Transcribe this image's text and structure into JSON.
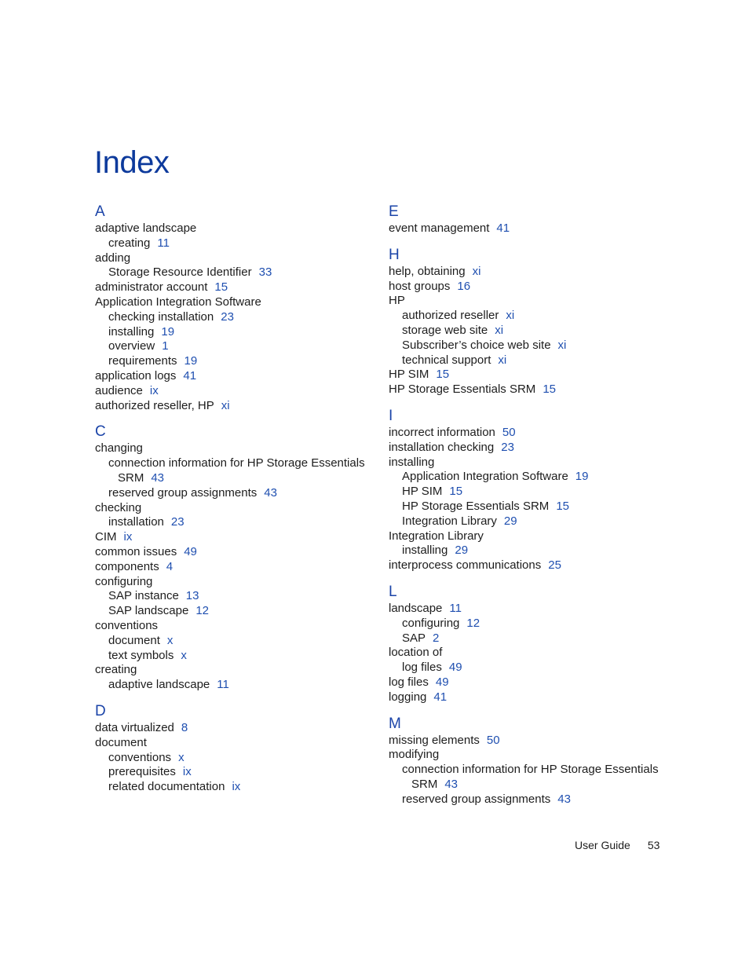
{
  "page": {
    "title": "Index",
    "footer": {
      "label": "User Guide",
      "page_number": "53"
    },
    "accent_color": "#1f4fb0"
  },
  "left_sections": [
    {
      "letter": "A",
      "entries": [
        {
          "text": "adaptive landscape",
          "page": "",
          "level": 0
        },
        {
          "text": "creating",
          "page": "11",
          "level": 1
        },
        {
          "text": "adding",
          "page": "",
          "level": 0
        },
        {
          "text": "Storage Resource Identifier",
          "page": "33",
          "level": 1
        },
        {
          "text": "administrator account",
          "page": "15",
          "level": 0
        },
        {
          "text": "Application Integration Software",
          "page": "",
          "level": 0
        },
        {
          "text": "checking installation",
          "page": "23",
          "level": 1
        },
        {
          "text": "installing",
          "page": "19",
          "level": 1
        },
        {
          "text": "overview",
          "page": "1",
          "level": 1
        },
        {
          "text": "requirements",
          "page": "19",
          "level": 1
        },
        {
          "text": "application logs",
          "page": "41",
          "level": 0
        },
        {
          "text": "audience",
          "page": "ix",
          "level": 0
        },
        {
          "text": "authorized reseller, HP",
          "page": "xi",
          "level": 0
        }
      ]
    },
    {
      "letter": "C",
      "entries": [
        {
          "text": "changing",
          "page": "",
          "level": 0
        },
        {
          "text": "connection information for HP Storage Essentials",
          "page": "",
          "level": 1
        },
        {
          "text": "SRM",
          "page": "43",
          "level": 2
        },
        {
          "text": "reserved group assignments",
          "page": "43",
          "level": 1
        },
        {
          "text": "checking",
          "page": "",
          "level": 0
        },
        {
          "text": "installation",
          "page": "23",
          "level": 1
        },
        {
          "text": "CIM",
          "page": "ix",
          "level": 0
        },
        {
          "text": "common issues",
          "page": "49",
          "level": 0
        },
        {
          "text": "components",
          "page": "4",
          "level": 0
        },
        {
          "text": "configuring",
          "page": "",
          "level": 0
        },
        {
          "text": "SAP instance",
          "page": "13",
          "level": 1
        },
        {
          "text": "SAP landscape",
          "page": "12",
          "level": 1
        },
        {
          "text": "conventions",
          "page": "",
          "level": 0
        },
        {
          "text": "document",
          "page": "x",
          "level": 1
        },
        {
          "text": "text symbols",
          "page": "x",
          "level": 1
        },
        {
          "text": "creating",
          "page": "",
          "level": 0
        },
        {
          "text": "adaptive landscape",
          "page": "11",
          "level": 1
        }
      ]
    },
    {
      "letter": "D",
      "entries": [
        {
          "text": "data virtualized",
          "page": "8",
          "level": 0
        },
        {
          "text": "document",
          "page": "",
          "level": 0
        },
        {
          "text": "conventions",
          "page": "x",
          "level": 1
        },
        {
          "text": "prerequisites",
          "page": "ix",
          "level": 1
        },
        {
          "text": "related documentation",
          "page": "ix",
          "level": 1
        }
      ]
    }
  ],
  "right_sections": [
    {
      "letter": "E",
      "entries": [
        {
          "text": "event management",
          "page": "41",
          "level": 0
        }
      ]
    },
    {
      "letter": "H",
      "entries": [
        {
          "text": "help, obtaining",
          "page": "xi",
          "level": 0
        },
        {
          "text": "host groups",
          "page": "16",
          "level": 0
        },
        {
          "text": "HP",
          "page": "",
          "level": 0
        },
        {
          "text": "authorized reseller",
          "page": "xi",
          "level": 1
        },
        {
          "text": "storage web site",
          "page": "xi",
          "level": 1
        },
        {
          "text": "Subscriber’s choice web site",
          "page": "xi",
          "level": 1
        },
        {
          "text": "technical support",
          "page": "xi",
          "level": 1
        },
        {
          "text": "HP SIM",
          "page": "15",
          "level": 0
        },
        {
          "text": "HP Storage Essentials SRM",
          "page": "15",
          "level": 0
        }
      ]
    },
    {
      "letter": "I",
      "entries": [
        {
          "text": "incorrect information",
          "page": "50",
          "level": 0
        },
        {
          "text": "installation checking",
          "page": "23",
          "level": 0
        },
        {
          "text": "installing",
          "page": "",
          "level": 0
        },
        {
          "text": "Application Integration Software",
          "page": "19",
          "level": 1
        },
        {
          "text": "HP SIM",
          "page": "15",
          "level": 1
        },
        {
          "text": "HP Storage Essentials SRM",
          "page": "15",
          "level": 1
        },
        {
          "text": "Integration Library",
          "page": "29",
          "level": 1
        },
        {
          "text": "Integration Library",
          "page": "",
          "level": 0
        },
        {
          "text": "installing",
          "page": "29",
          "level": 1
        },
        {
          "text": "interprocess communications",
          "page": "25",
          "level": 0
        }
      ]
    },
    {
      "letter": "L",
      "entries": [
        {
          "text": "landscape",
          "page": "11",
          "level": 0
        },
        {
          "text": "configuring",
          "page": "12",
          "level": 1
        },
        {
          "text": "SAP",
          "page": "2",
          "level": 1
        },
        {
          "text": "location of",
          "page": "",
          "level": 0
        },
        {
          "text": "log files",
          "page": "49",
          "level": 1
        },
        {
          "text": "log files",
          "page": "49",
          "level": 0
        },
        {
          "text": "logging",
          "page": "41",
          "level": 0
        }
      ]
    },
    {
      "letter": "M",
      "entries": [
        {
          "text": "missing elements",
          "page": "50",
          "level": 0
        },
        {
          "text": "modifying",
          "page": "",
          "level": 0
        },
        {
          "text": "connection information for HP Storage Essentials",
          "page": "",
          "level": 1
        },
        {
          "text": "SRM",
          "page": "43",
          "level": 2
        },
        {
          "text": "reserved group assignments",
          "page": "43",
          "level": 1
        }
      ]
    }
  ]
}
